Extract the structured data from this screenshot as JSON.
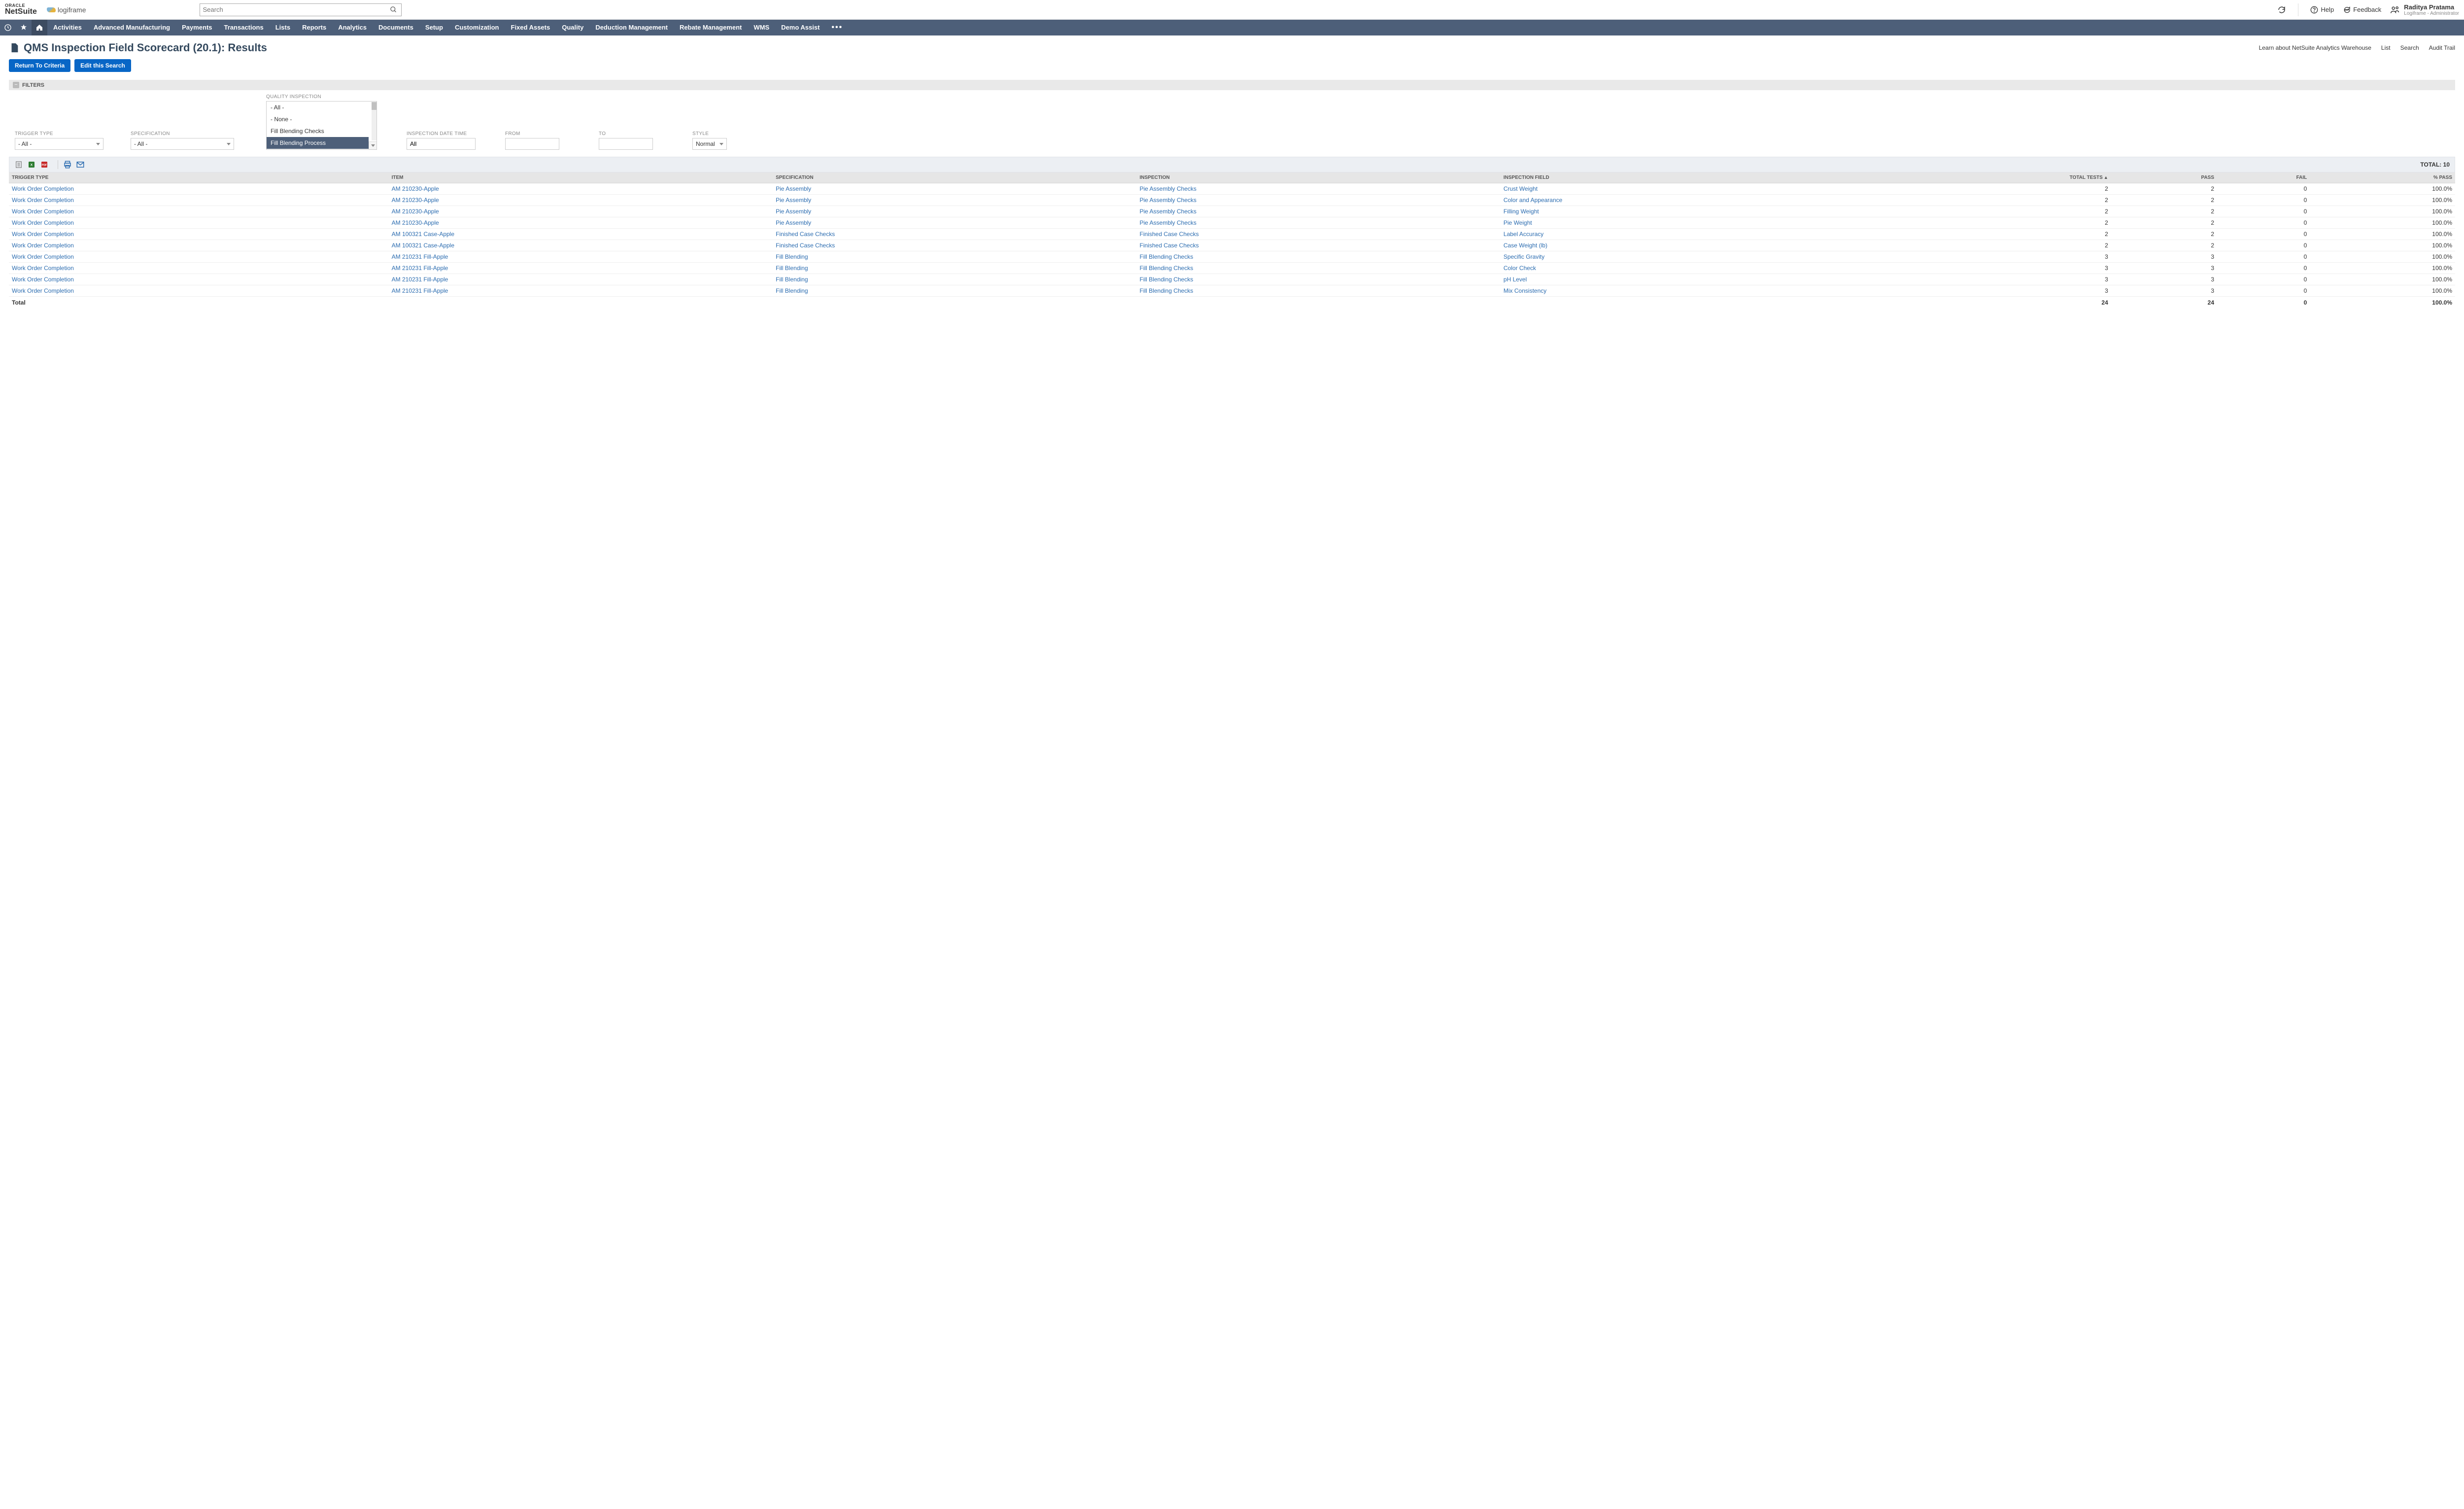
{
  "header": {
    "logo_oracle": "ORACLE",
    "logo_netsuite": "NetSuite",
    "logo2": "logiframe",
    "search_placeholder": "Search",
    "help": "Help",
    "feedback": "Feedback",
    "user_name": "Raditya Pratama",
    "user_role": "Logiframe - Administrator"
  },
  "nav": {
    "items": [
      "Activities",
      "Advanced Manufacturing",
      "Payments",
      "Transactions",
      "Lists",
      "Reports",
      "Analytics",
      "Documents",
      "Setup",
      "Customization",
      "Fixed Assets",
      "Quality",
      "Deduction Management",
      "Rebate Management",
      "WMS",
      "Demo Assist"
    ]
  },
  "page": {
    "title": "QMS Inspection Field Scorecard (20.1): Results",
    "links": {
      "learn": "Learn about NetSuite Analytics Warehouse",
      "list": "List",
      "search": "Search",
      "audit": "Audit Trail"
    },
    "btn_return": "Return To Criteria",
    "btn_edit": "Edit this Search"
  },
  "filters": {
    "label": "FILTERS",
    "trigger_type": {
      "label": "TRIGGER TYPE",
      "value": "- All -"
    },
    "specification": {
      "label": "SPECIFICATION",
      "value": "- All -"
    },
    "inspection": {
      "label": "QUALITY INSPECTION",
      "options": [
        "- All -",
        "- None -",
        "Fill Blending Checks",
        "Fill Blending Process"
      ],
      "selected": "Fill Blending Process"
    },
    "inspection_datetime": {
      "label": "INSPECTION DATE TIME",
      "value": "All"
    },
    "from": {
      "label": "FROM",
      "value": ""
    },
    "to": {
      "label": "TO",
      "value": ""
    },
    "style": {
      "label": "STYLE",
      "value": "Normal"
    }
  },
  "totalbar": {
    "label": "TOTAL:",
    "value": "10"
  },
  "columns": {
    "trigger": "TRIGGER TYPE",
    "item": "ITEM",
    "spec": "SPECIFICATION",
    "insp": "INSPECTION",
    "field": "INSPECTION FIELD",
    "tests": "TOTAL TESTS",
    "sort": "▲",
    "pass": "PASS",
    "fail": "FAIL",
    "pct": "% PASS"
  },
  "rows": [
    {
      "trigger": "Work Order Completion",
      "item": "AM 210230-Apple",
      "spec": "Pie Assembly",
      "insp": "Pie Assembly Checks",
      "field": "Crust Weight",
      "tests": "2",
      "pass": "2",
      "fail": "0",
      "pct": "100.0%"
    },
    {
      "trigger": "Work Order Completion",
      "item": "AM 210230-Apple",
      "spec": "Pie Assembly",
      "insp": "Pie Assembly Checks",
      "field": "Color and Appearance",
      "tests": "2",
      "pass": "2",
      "fail": "0",
      "pct": "100.0%"
    },
    {
      "trigger": "Work Order Completion",
      "item": "AM 210230-Apple",
      "spec": "Pie Assembly",
      "insp": "Pie Assembly Checks",
      "field": "Filling Weight",
      "tests": "2",
      "pass": "2",
      "fail": "0",
      "pct": "100.0%"
    },
    {
      "trigger": "Work Order Completion",
      "item": "AM 210230-Apple",
      "spec": "Pie Assembly",
      "insp": "Pie Assembly Checks",
      "field": "Pie Weight",
      "tests": "2",
      "pass": "2",
      "fail": "0",
      "pct": "100.0%"
    },
    {
      "trigger": "Work Order Completion",
      "item": "AM 100321 Case-Apple",
      "spec": "Finished Case Checks",
      "insp": "Finished Case Checks",
      "field": "Label Accuracy",
      "tests": "2",
      "pass": "2",
      "fail": "0",
      "pct": "100.0%"
    },
    {
      "trigger": "Work Order Completion",
      "item": "AM 100321 Case-Apple",
      "spec": "Finished Case Checks",
      "insp": "Finished Case Checks",
      "field": "Case Weight (lb)",
      "tests": "2",
      "pass": "2",
      "fail": "0",
      "pct": "100.0%"
    },
    {
      "trigger": "Work Order Completion",
      "item": "AM 210231 Fill-Apple",
      "spec": "Fill Blending",
      "insp": "Fill Blending Checks",
      "field": "Specific Gravity",
      "tests": "3",
      "pass": "3",
      "fail": "0",
      "pct": "100.0%"
    },
    {
      "trigger": "Work Order Completion",
      "item": "AM 210231 Fill-Apple",
      "spec": "Fill Blending",
      "insp": "Fill Blending Checks",
      "field": "Color Check",
      "tests": "3",
      "pass": "3",
      "fail": "0",
      "pct": "100.0%"
    },
    {
      "trigger": "Work Order Completion",
      "item": "AM 210231 Fill-Apple",
      "spec": "Fill Blending",
      "insp": "Fill Blending Checks",
      "field": "pH Level",
      "tests": "3",
      "pass": "3",
      "fail": "0",
      "pct": "100.0%"
    },
    {
      "trigger": "Work Order Completion",
      "item": "AM 210231 Fill-Apple",
      "spec": "Fill Blending",
      "insp": "Fill Blending Checks",
      "field": "Mix Consistency",
      "tests": "3",
      "pass": "3",
      "fail": "0",
      "pct": "100.0%"
    }
  ],
  "footer": {
    "label": "Total",
    "tests": "24",
    "pass": "24",
    "fail": "0",
    "pct": "100.0%"
  }
}
